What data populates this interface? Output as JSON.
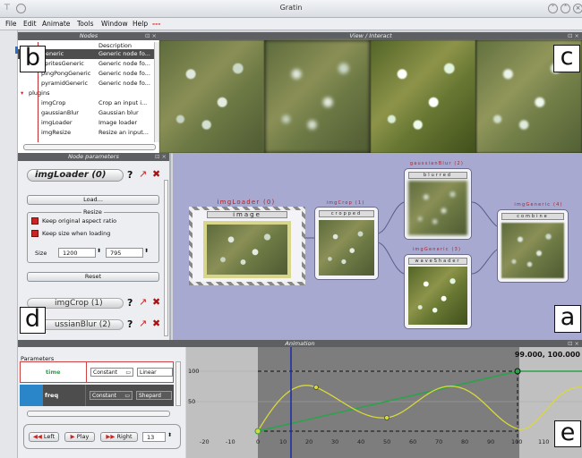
{
  "window": {
    "title": "Gratin"
  },
  "menu": [
    "File",
    "Edit",
    "Animate",
    "Tools",
    "Window",
    "Help",
    "---"
  ],
  "panels": {
    "nodes": "Nodes",
    "view": "View / Interact",
    "params": "Node parameters",
    "animation": "Animation"
  },
  "letters": {
    "b": "b",
    "c": "c",
    "d": "d",
    "a": "a",
    "e": "e"
  },
  "nodes_list": {
    "header_desc": "Description",
    "rows": [
      {
        "name": "Generic",
        "desc": "Generic node fo...",
        "selected": true
      },
      {
        "name": "SpritesGeneric",
        "desc": "Generic node fo...",
        "selected": false
      },
      {
        "name": "pingPongGeneric",
        "desc": "Generic node fo...",
        "selected": false
      },
      {
        "name": "pyramidGeneric",
        "desc": "Generic node fo...",
        "selected": false
      },
      {
        "name": "plugins",
        "desc": "",
        "selected": false
      },
      {
        "name": "imgCrop",
        "desc": "Crop an input i...",
        "selected": false
      },
      {
        "name": "gaussianBlur",
        "desc": "Gaussian blur",
        "selected": false
      },
      {
        "name": "imgLoader",
        "desc": "Image loader",
        "selected": false
      },
      {
        "name": "imgResize",
        "desc": "Resize an input...",
        "selected": false
      }
    ]
  },
  "node_params": {
    "node_title": "imgLoader (0)",
    "help": "?",
    "load_btn": "Load...",
    "resize_group": "Resize",
    "keep_aspect": "Keep original aspect ratio",
    "keep_size": "Keep size when loading",
    "size_label": "Size",
    "width": "1200",
    "height": "795",
    "reset_btn": "Reset",
    "collapsed": [
      {
        "title": "imgCrop (1)"
      },
      {
        "title": "ussianBlur (2)"
      }
    ]
  },
  "graph": {
    "nodes": [
      {
        "label": "imgLoader (0)",
        "output": "image"
      },
      {
        "label": "imgCrop (1)",
        "output": "cropped"
      },
      {
        "label": "gaussianBlur (2)",
        "output": "blurred"
      },
      {
        "label": "imgGeneric (3)",
        "output": "waveShader"
      },
      {
        "label": "imgGeneric (4)",
        "output": "combine"
      }
    ]
  },
  "animation": {
    "params_label": "Parameters",
    "rows": [
      {
        "name": "time",
        "interp": "Constant",
        "curve": "Linear"
      },
      {
        "name": "freq",
        "interp": "Constant",
        "curve": "Shepard"
      }
    ],
    "left_btn": "Left",
    "play_btn": "Play",
    "right_btn": "Right",
    "frame": "13",
    "coord_readout": "99.000, 100.000",
    "current_frame": 13,
    "x_ticks": [
      "-20",
      "-10",
      "0",
      "10",
      "20",
      "30",
      "40",
      "50",
      "60",
      "70",
      "80",
      "90",
      "100",
      "110"
    ],
    "y_ticks": [
      "100",
      "50"
    ],
    "colors": {
      "linear": "#2aa34a",
      "shepard": "#d8d83a",
      "cursor": "#1b2aa8"
    }
  }
}
